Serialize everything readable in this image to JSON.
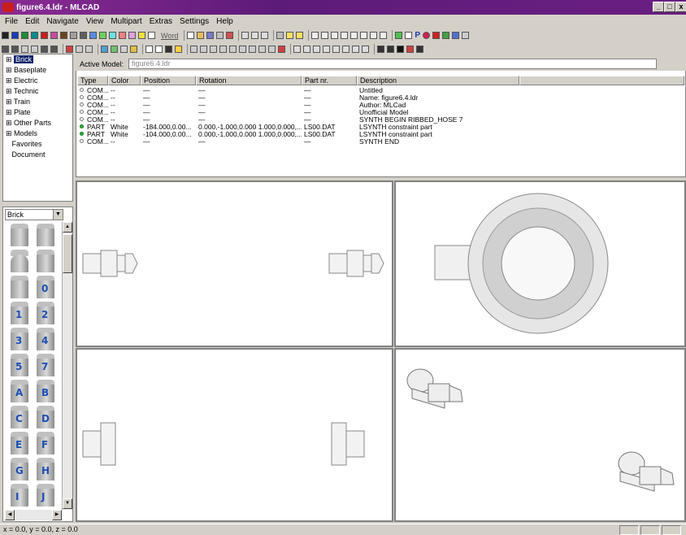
{
  "window": {
    "title": "figure6.4.ldr - MLCAD",
    "min_label": "_",
    "max_label": "□",
    "close_label": "x"
  },
  "menu": [
    "File",
    "Edit",
    "Navigate",
    "View",
    "Multipart",
    "Extras",
    "Settings",
    "Help"
  ],
  "toolbar": {
    "word_label": "Word"
  },
  "tree": {
    "items": [
      "Brick",
      "Baseplate",
      "Electric",
      "Technic",
      "Train",
      "Plate",
      "Other Parts",
      "Models",
      "Favorites",
      "Document"
    ]
  },
  "palette": {
    "category": "Brick",
    "brick_labels": [
      "",
      "",
      "",
      "",
      "",
      "0",
      "1",
      "2",
      "3",
      "4",
      "5",
      "7",
      "A",
      "B",
      "C",
      "D",
      "E",
      "F",
      "G",
      "H",
      "I",
      "J"
    ]
  },
  "active_model": {
    "label": "Active Model:",
    "value": "figure6.4.ldr"
  },
  "list": {
    "headers": [
      "Type",
      "Color",
      "Position",
      "Rotation",
      "Part nr.",
      "Description"
    ],
    "rows": [
      {
        "type": "COM...",
        "color": "--",
        "position": "—",
        "rotation": "—",
        "part": "—",
        "desc": "Untitled"
      },
      {
        "type": "COM...",
        "color": "--",
        "position": "—",
        "rotation": "—",
        "part": "—",
        "desc": "Name: figure6.4.ldr"
      },
      {
        "type": "COM...",
        "color": "--",
        "position": "—",
        "rotation": "—",
        "part": "—",
        "desc": "Author: MLCad"
      },
      {
        "type": "COM...",
        "color": "--",
        "position": "—",
        "rotation": "—",
        "part": "—",
        "desc": "Unofficial Model"
      },
      {
        "type": "COM...",
        "color": "--",
        "position": "—",
        "rotation": "—",
        "part": "—",
        "desc": "SYNTH BEGIN RIBBED_HOSE 7"
      },
      {
        "type": "PART",
        "color": "White",
        "position": "-184.000,0.00...",
        "rotation": "0.000,-1.000,0.000 1.000,0.000,...",
        "part": "LS00.DAT",
        "desc": "LSYNTH constraint part"
      },
      {
        "type": "PART",
        "color": "White",
        "position": "-104.000,0.00...",
        "rotation": "0.000,-1.000,0.000 1.000,0.000,...",
        "part": "LS00.DAT",
        "desc": "LSYNTH constraint part"
      },
      {
        "type": "COM...",
        "color": "--",
        "position": "—",
        "rotation": "—",
        "part": "—",
        "desc": "SYNTH END"
      }
    ]
  },
  "status": {
    "coords": "x = 0.0, y = 0.0, z = 0.0"
  },
  "colors": {
    "title_bar": "#6a1f82",
    "selection": "#0a246a",
    "part_icon": "#2cb03a",
    "brick_label": "#1c4fb3"
  }
}
